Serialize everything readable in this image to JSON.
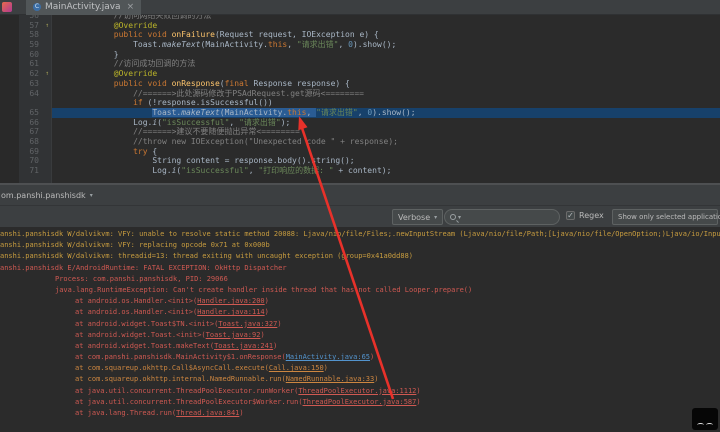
{
  "colors": {
    "warn": "#c79c3f",
    "err": "#cf5952",
    "sdk_frame": "#cd8640",
    "link_blue": "#5394ce",
    "selection": "#2a5c94",
    "line_highlight": "#17416b",
    "arrow": "#e8312a"
  },
  "icons": {
    "chevron_down": "▾",
    "close": "×",
    "class_badge": "C",
    "overridden": "↑",
    "check": "✓"
  },
  "tab_bar": {
    "tab": {
      "title": "MainActivity.java"
    }
  },
  "editor": {
    "highlighted_line": "65",
    "lines": [
      {
        "num": "56",
        "tokens": [
          [
            "cmt",
            "            //访问网络失败回调的方法"
          ]
        ]
      },
      {
        "num": "57",
        "icon": "override",
        "tokens": [
          [
            "def",
            "            "
          ],
          [
            "ann",
            "@Override"
          ]
        ]
      },
      {
        "num": "58",
        "tokens": [
          [
            "def",
            "            "
          ],
          [
            "kw",
            "public "
          ],
          [
            "kw",
            "void "
          ],
          [
            "mth",
            "onFailure"
          ],
          [
            "def",
            "(Request request, IOException e) {"
          ]
        ]
      },
      {
        "num": "59",
        "tokens": [
          [
            "def",
            "                Toast."
          ],
          [
            "call",
            "makeText"
          ],
          [
            "def",
            "(MainActivity."
          ],
          [
            "kw",
            "this"
          ],
          [
            "def",
            ", "
          ],
          [
            "str",
            "\"请求出错\""
          ],
          [
            "def",
            ", "
          ],
          [
            "num",
            "0"
          ],
          [
            "def",
            ").show();"
          ]
        ]
      },
      {
        "num": "60",
        "tokens": [
          [
            "def",
            "            }"
          ]
        ]
      },
      {
        "num": "61",
        "tokens": [
          [
            "cmt",
            "            //访问成功回调的方法"
          ]
        ]
      },
      {
        "num": "62",
        "icon": "override",
        "tokens": [
          [
            "def",
            "            "
          ],
          [
            "ann",
            "@Override"
          ]
        ]
      },
      {
        "num": "63",
        "tokens": [
          [
            "def",
            "            "
          ],
          [
            "kw",
            "public "
          ],
          [
            "kw",
            "void "
          ],
          [
            "mth",
            "onResponse"
          ],
          [
            "def",
            "("
          ],
          [
            "kw",
            "final "
          ],
          [
            "def",
            "Response response) {"
          ]
        ]
      },
      {
        "num": "64",
        "tokens": [
          [
            "cmt",
            "                //======>此处源码修改于PSAdRequest.get源码<========"
          ]
        ]
      },
      {
        "num": "",
        "tokens": [
          [
            "def",
            "                "
          ],
          [
            "kw",
            "if "
          ],
          [
            "def",
            "(!response.isSuccessful())"
          ]
        ]
      },
      {
        "num": "65",
        "hl": true,
        "tokens": [
          [
            "def",
            "                    "
          ],
          [
            "sel",
            "Toast."
          ],
          [
            "sel call",
            "makeText"
          ],
          [
            "sel",
            "(MainActivity."
          ],
          [
            "sel kw",
            "this"
          ],
          [
            "sel",
            ", "
          ],
          [
            "str",
            "\"请求出错\""
          ],
          [
            "def",
            ", "
          ],
          [
            "num",
            "0"
          ],
          [
            "def",
            ").show();"
          ]
        ]
      },
      {
        "num": "66",
        "tokens": [
          [
            "def",
            "                Log."
          ],
          [
            "call",
            "i"
          ],
          [
            "def",
            "("
          ],
          [
            "str",
            "\"isSuccessful\""
          ],
          [
            "def",
            ", "
          ],
          [
            "str",
            "\"请求出错\""
          ],
          [
            "def",
            ");"
          ]
        ]
      },
      {
        "num": "67",
        "tokens": [
          [
            "cmt",
            "                //======>建议不要随便抛出异常<========"
          ]
        ]
      },
      {
        "num": "68",
        "tokens": [
          [
            "cmt",
            "                //throw new IOException(\"Unexpected code \" + response);"
          ]
        ]
      },
      {
        "num": "69",
        "tokens": [
          [
            "def",
            "                "
          ],
          [
            "kw",
            "try "
          ],
          [
            "def",
            "{"
          ]
        ]
      },
      {
        "num": "70",
        "tokens": [
          [
            "def",
            "                    String content = response.body().string();"
          ]
        ]
      },
      {
        "num": "71",
        "tokens": [
          [
            "def",
            "                    Log."
          ],
          [
            "call",
            "i"
          ],
          [
            "def",
            "("
          ],
          [
            "str",
            "\"isSuccessful\""
          ],
          [
            "def",
            ", "
          ],
          [
            "str",
            "\"打印响应的数据: \""
          ],
          [
            "def",
            " + content);"
          ]
        ]
      }
    ]
  },
  "logcat": {
    "process": "om.panshi.panshisdk",
    "toolbar": {
      "level": "Verbose",
      "search_value": "",
      "regex_label": "Regex",
      "filter_label": "Show only selected application"
    },
    "lines": [
      {
        "cls": "warn",
        "pad": 0,
        "segs": [
          [
            "t",
            "anshi.panshisdk W/dalvikvm: VFY: unable to resolve static method 20088: Ljava/nio/file/Files;.newInputStream (Ljava/nio/file/Path;[Ljava/nio/file/OpenOption;)Ljava/io/InputStream;"
          ]
        ]
      },
      {
        "cls": "warn",
        "pad": 0,
        "segs": [
          [
            "t",
            "anshi.panshisdk W/dalvikvm: VFY: replacing opcode 0x71 at 0x000b"
          ]
        ]
      },
      {
        "cls": "warn",
        "pad": 0,
        "segs": [
          [
            "t",
            "anshi.panshisdk W/dalvikvm: threadid=13: thread exiting with uncaught exception (group=0x41a0dd88)"
          ]
        ]
      },
      {
        "cls": "err",
        "pad": 0,
        "segs": [
          [
            "t",
            "anshi.panshisdk E/AndroidRuntime: FATAL EXCEPTION: OkHttp Dispatcher"
          ]
        ]
      },
      {
        "cls": "err",
        "pad": 55,
        "segs": [
          [
            "t",
            "Process: com.panshi.panshisdk, PID: 29066"
          ]
        ]
      },
      {
        "cls": "err",
        "pad": 55,
        "segs": [
          [
            "t",
            "java.lang.RuntimeException: Can't create handler inside thread that has not called Looper.prepare()"
          ]
        ]
      },
      {
        "cls": "err",
        "pad": 75,
        "segs": [
          [
            "t",
            "at android.os.Handler.<init>("
          ],
          [
            "link",
            "Handler.java:200"
          ],
          [
            "t",
            ")"
          ]
        ]
      },
      {
        "cls": "err",
        "pad": 75,
        "segs": [
          [
            "t",
            "at android.os.Handler.<init>("
          ],
          [
            "link",
            "Handler.java:114"
          ],
          [
            "t",
            ")"
          ]
        ]
      },
      {
        "cls": "err",
        "pad": 75,
        "segs": [
          [
            "t",
            "at android.widget.Toast$TN.<init>("
          ],
          [
            "link",
            "Toast.java:327"
          ],
          [
            "t",
            ")"
          ]
        ]
      },
      {
        "cls": "err",
        "pad": 75,
        "segs": [
          [
            "t",
            "at android.widget.Toast.<init>("
          ],
          [
            "link",
            "Toast.java:92"
          ],
          [
            "t",
            ")"
          ]
        ]
      },
      {
        "cls": "err",
        "pad": 75,
        "segs": [
          [
            "t",
            "at android.widget.Toast.makeText("
          ],
          [
            "link",
            "Toast.java:241"
          ],
          [
            "t",
            ")"
          ]
        ]
      },
      {
        "cls": "err",
        "pad": 75,
        "segs": [
          [
            "t",
            "at com.panshi.panshisdk.MainActivity$1.onResponse("
          ],
          [
            "blue",
            "MainActivity.java:65"
          ],
          [
            "t",
            ")"
          ]
        ]
      },
      {
        "cls": "orange",
        "pad": 75,
        "segs": [
          [
            "t",
            "at com.squareup.okhttp.Call$AsyncCall.execute("
          ],
          [
            "link",
            "Call.java:150"
          ],
          [
            "t",
            ")"
          ]
        ]
      },
      {
        "cls": "orange",
        "pad": 75,
        "segs": [
          [
            "t",
            "at com.squareup.okhttp.internal.NamedRunnable.run("
          ],
          [
            "link",
            "NamedRunnable.java:33"
          ],
          [
            "t",
            ")"
          ]
        ]
      },
      {
        "cls": "err",
        "pad": 75,
        "segs": [
          [
            "t",
            "at java.util.concurrent.ThreadPoolExecutor.runWorker("
          ],
          [
            "link",
            "ThreadPoolExecutor.java:1112"
          ],
          [
            "t",
            ")"
          ]
        ]
      },
      {
        "cls": "err",
        "pad": 75,
        "segs": [
          [
            "t",
            "at java.util.concurrent.ThreadPoolExecutor$Worker.run("
          ],
          [
            "link",
            "ThreadPoolExecutor.java:587"
          ],
          [
            "t",
            ")"
          ]
        ]
      },
      {
        "cls": "err",
        "pad": 75,
        "segs": [
          [
            "t",
            "at java.lang.Thread.run("
          ],
          [
            "link",
            "Thread.java:841"
          ],
          [
            "t",
            ")"
          ]
        ]
      }
    ]
  }
}
